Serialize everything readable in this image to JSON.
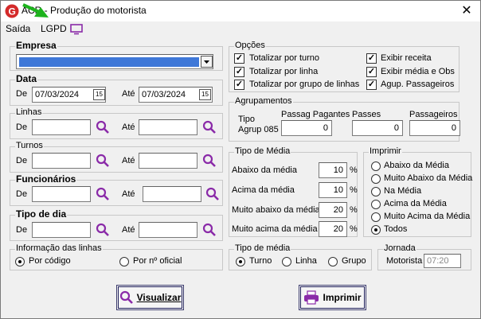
{
  "window": {
    "title": "ACR - Produção do motorista",
    "close": "✕"
  },
  "menu": {
    "saida": "Saída",
    "lgpd": "LGPD"
  },
  "empresa": {
    "label": "Empresa",
    "value": ""
  },
  "data": {
    "label": "Data",
    "de": "De",
    "ate": "Até",
    "de_value": "07/03/2024",
    "ate_value": "07/03/2024",
    "cal_icon": "15"
  },
  "linhas": {
    "label": "Linhas",
    "de": "De",
    "ate": "Até"
  },
  "turnos": {
    "label": "Turnos",
    "de": "De",
    "ate": "Até"
  },
  "funcionarios": {
    "label": "Funcionários",
    "de": "De",
    "ate": "Até"
  },
  "tipo_dia": {
    "label": "Tipo de dia",
    "de": "De",
    "ate": "Até"
  },
  "info_linhas": {
    "label": "Informação das linhas",
    "por_codigo": "Por código",
    "por_oficial": "Por nº oficial"
  },
  "opcoes": {
    "label": "Opções",
    "totalizar_turno": "Totalizar por turno",
    "totalizar_linha": "Totalizar por linha",
    "totalizar_grupo": "Totalizar por grupo de linhas",
    "exibir_receita": "Exibir receita",
    "exibir_media": "Exibir média e Obs",
    "agup_passageiros": "Agup. Passageiros"
  },
  "agrupamentos": {
    "label": "Agrupamentos",
    "tipo": "Tipo",
    "agrup": "Agrup 085",
    "passag_pagantes": "Passag Pagantes",
    "passes": "Passes",
    "passageiros": "Passageiros",
    "v1": "0",
    "v2": "0",
    "v3": "0"
  },
  "tipo_media": {
    "label": "Tipo de Média",
    "abaixo": "Abaixo da média",
    "abaixo_v": "10",
    "acima": "Acima da média",
    "acima_v": "10",
    "muito_abaixo": "Muito abaixo da média",
    "muito_abaixo_v": "20",
    "muito_acima": "Muito acima da média",
    "muito_acima_v": "20",
    "pct": "%"
  },
  "imprimir_group": {
    "label": "Imprimir",
    "abaixo": "Abaixo da Média",
    "muito_abaixo": "Muito Abaixo da Média",
    "na_media": "Na Média",
    "acima": "Acima da Média",
    "muito_acima": "Muito Acima da Média",
    "todos": "Todos"
  },
  "tipo_media2": {
    "label": "Tipo de média",
    "turno": "Turno",
    "linha": "Linha",
    "grupo": "Grupo"
  },
  "jornada": {
    "label": "Jornada",
    "motorista": "Motorista",
    "value": "07:20"
  },
  "buttons": {
    "visualizar": "Visualizar",
    "imprimir": "Imprimir"
  }
}
